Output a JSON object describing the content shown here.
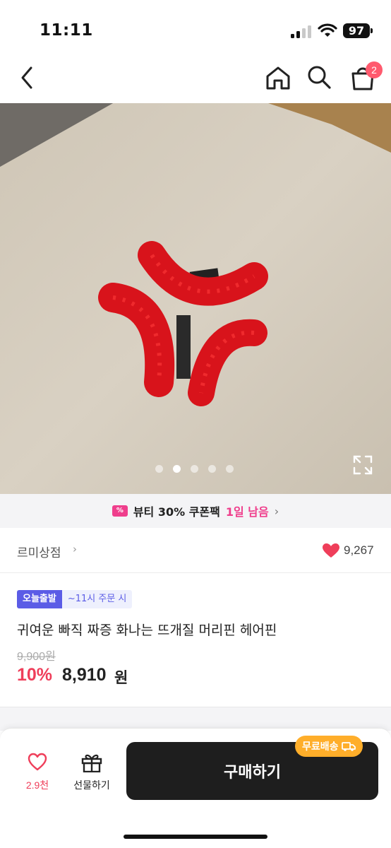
{
  "status_bar": {
    "time": "11:11",
    "battery": "97"
  },
  "nav": {
    "cart_badge": "2"
  },
  "gallery": {
    "image_count": 5,
    "current_index": 2
  },
  "coupon_banner": {
    "icon_text": "%",
    "text": "뷰티 30% 쿠폰팩",
    "days": "1일 남음"
  },
  "store": {
    "name": "르미상점",
    "likes": "9,267"
  },
  "product": {
    "tag_primary": "오늘출발",
    "tag_secondary": "~11시 주문 시",
    "title": "귀여운 빠직 짜증 화나는 뜨개질 머리핀 헤어핀",
    "original_price": "9,900원",
    "discount_rate": "10%",
    "sale_price": "8,910",
    "sale_unit": "원"
  },
  "bottom_bar": {
    "wish_count": "2.9천",
    "gift_label": "선물하기",
    "buy_label": "구매하기",
    "free_shipping": "무료배송"
  },
  "colors": {
    "accent_pink": "#ef3e5a",
    "tag_purple": "#5b5ce6",
    "shipping_orange": "#ffae2a",
    "coupon_pink": "#ef3e8c"
  },
  "icons": [
    "back-icon",
    "home-icon",
    "search-icon",
    "cart-icon",
    "expand-icon",
    "heart-icon",
    "gift-icon",
    "truck-icon"
  ]
}
